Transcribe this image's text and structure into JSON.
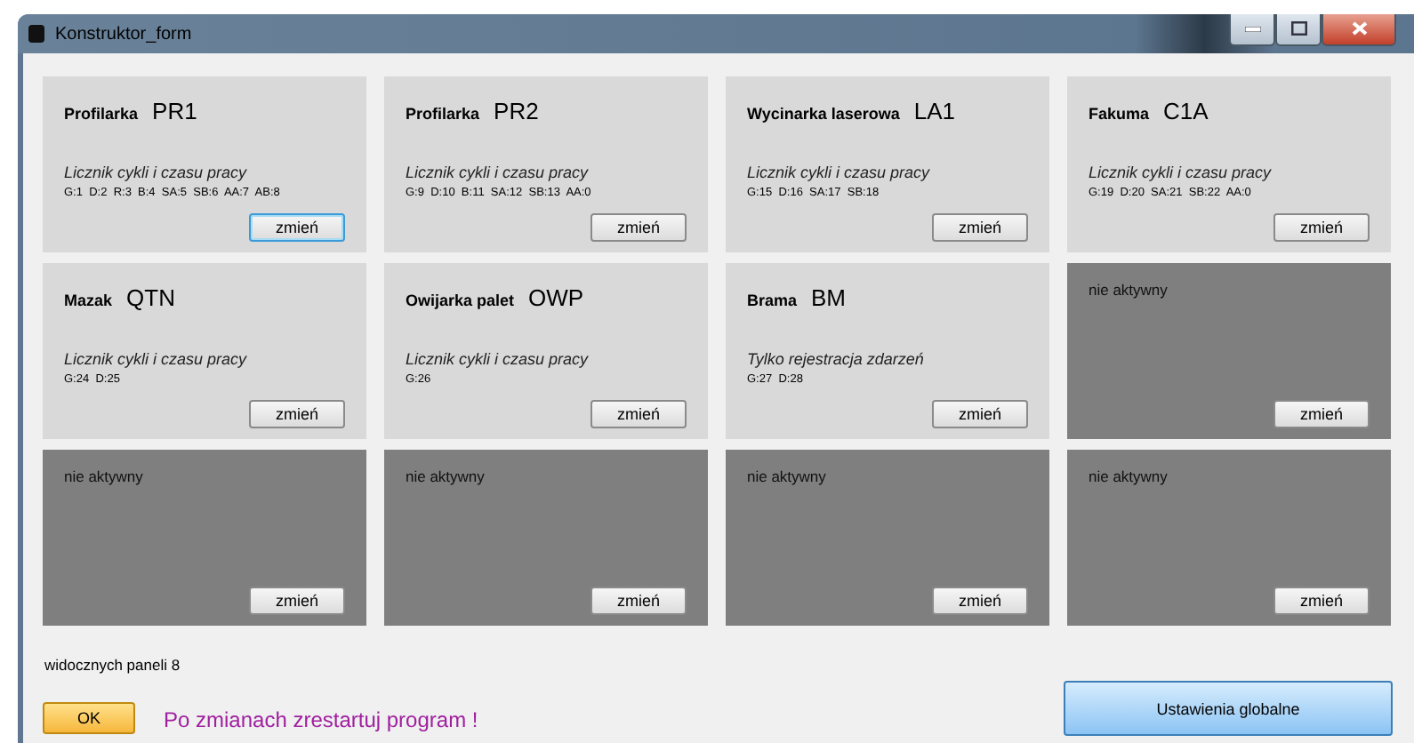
{
  "window": {
    "title": "Konstruktor_form"
  },
  "panels": [
    {
      "kind": "active",
      "type": "Profilarka",
      "code": "PR1",
      "description": "Licznik cykli i czasu pracy",
      "counters": "G:1  D:2  R:3  B:4  SA:5  SB:6  AA:7  AB:8",
      "button": "zmień",
      "focused": true
    },
    {
      "kind": "active",
      "type": "Profilarka",
      "code": "PR2",
      "description": "Licznik cykli i czasu pracy",
      "counters": "G:9  D:10  B:11  SA:12  SB:13  AA:0",
      "button": "zmień",
      "focused": false
    },
    {
      "kind": "active",
      "type": "Wycinarka laserowa",
      "code": "LA1",
      "description": "Licznik cykli i czasu pracy",
      "counters": "G:15  D:16  SA:17  SB:18",
      "button": "zmień",
      "focused": false
    },
    {
      "kind": "active",
      "type": "Fakuma",
      "code": "C1A",
      "description": "Licznik cykli i czasu pracy",
      "counters": "G:19  D:20  SA:21  SB:22  AA:0",
      "button": "zmień",
      "focused": false
    },
    {
      "kind": "active",
      "type": "Mazak",
      "code": "QTN",
      "description": "Licznik cykli i czasu pracy",
      "counters": "G:24  D:25",
      "button": "zmień",
      "focused": false
    },
    {
      "kind": "active",
      "type": "Owijarka palet",
      "code": "OWP",
      "description": "Licznik cykli i czasu pracy",
      "counters": "G:26",
      "button": "zmień",
      "focused": false
    },
    {
      "kind": "active",
      "type": "Brama",
      "code": "BM",
      "description": "Tylko rejestracja zdarzeń",
      "counters": "G:27  D:28",
      "button": "zmień",
      "focused": false
    },
    {
      "kind": "inactive",
      "label": "nie aktywny",
      "button": "zmień",
      "focused": false
    },
    {
      "kind": "inactive",
      "label": "nie aktywny",
      "button": "zmień",
      "focused": false
    },
    {
      "kind": "inactive",
      "label": "nie aktywny",
      "button": "zmień",
      "focused": false
    },
    {
      "kind": "inactive",
      "label": "nie aktywny",
      "button": "zmień",
      "focused": false
    },
    {
      "kind": "inactive",
      "label": "nie aktywny",
      "button": "zmień",
      "focused": false
    }
  ],
  "visible_count": "widocznych paneli 8",
  "ok_button": "OK",
  "restart_message": "Po zmianach zrestartuj program !",
  "global_settings_button": "Ustawienia globalne"
}
